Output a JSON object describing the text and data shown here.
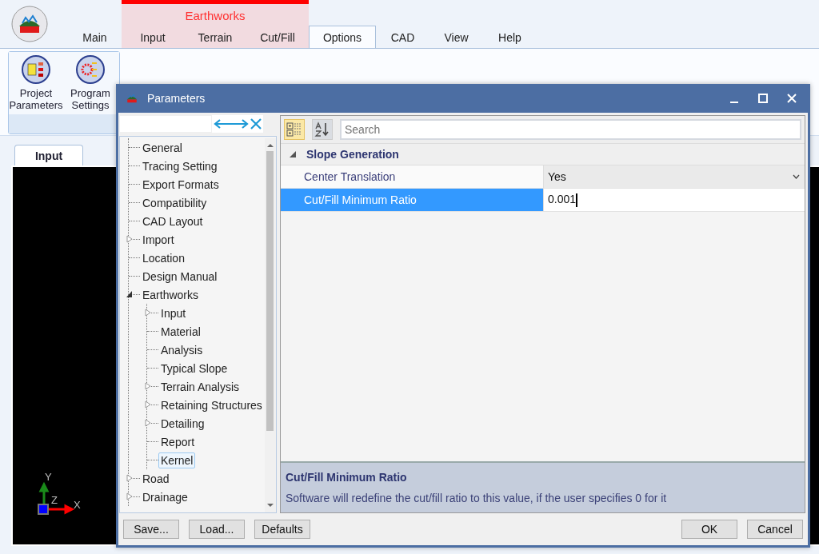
{
  "ribbon": {
    "context_group": "Earthworks",
    "tabs": [
      {
        "label": "Main",
        "kind": "plain",
        "selected": false
      },
      {
        "label": "Input",
        "kind": "contextual",
        "selected": false
      },
      {
        "label": "Terrain",
        "kind": "contextual",
        "selected": false
      },
      {
        "label": "Cut/Fill",
        "kind": "contextual",
        "selected": false
      },
      {
        "label": "Options",
        "kind": "plain",
        "selected": true
      },
      {
        "label": "CAD",
        "kind": "plain",
        "selected": false
      },
      {
        "label": "View",
        "kind": "plain",
        "selected": false
      },
      {
        "label": "Help",
        "kind": "plain",
        "selected": false
      }
    ],
    "buttons": [
      {
        "label": "Project Parameters",
        "kind": "project"
      },
      {
        "label": "Program Settings",
        "kind": "settings"
      }
    ]
  },
  "document_tabs": [
    {
      "label": "Input",
      "selected": true
    }
  ],
  "canvas_axes": {
    "y": "Y",
    "z": "Z",
    "x": "X"
  },
  "dialog": {
    "title": "Parameters",
    "tree": [
      {
        "label": "General",
        "selected": false
      },
      {
        "label": "Tracing Setting",
        "selected": false
      },
      {
        "label": "Export Formats",
        "selected": false
      },
      {
        "label": "Compatibility",
        "selected": false
      },
      {
        "label": "CAD Layout",
        "selected": false
      },
      {
        "label": "Import",
        "selected": false,
        "expanded": false
      },
      {
        "label": "Location",
        "selected": false
      },
      {
        "label": "Design Manual",
        "selected": false
      },
      {
        "label": "Earthworks",
        "selected": false,
        "expanded": true,
        "children": [
          {
            "label": "Input",
            "selected": false,
            "expanded": false
          },
          {
            "label": "Material",
            "selected": false
          },
          {
            "label": "Analysis",
            "selected": false
          },
          {
            "label": "Typical Slope",
            "selected": false
          },
          {
            "label": "Terrain Analysis",
            "selected": false,
            "expanded": false
          },
          {
            "label": "Retaining Structures",
            "selected": false,
            "expanded": false
          },
          {
            "label": "Detailing",
            "selected": false,
            "expanded": false
          },
          {
            "label": "Report",
            "selected": false
          },
          {
            "label": "Kernel",
            "selected": true
          }
        ]
      },
      {
        "label": "Road",
        "selected": false,
        "expanded": false
      },
      {
        "label": "Drainage",
        "selected": false,
        "expanded": false
      }
    ],
    "toolbar": [
      {
        "kind": "categorized",
        "selected": true
      },
      {
        "kind": "alphabetical",
        "selected": false
      }
    ],
    "search": {
      "placeholder": "Search"
    },
    "category": {
      "label": "Slope Generation",
      "expanded": true
    },
    "properties": [
      {
        "name": "Center Translation",
        "value": "Yes",
        "kind": "dropdown",
        "selected": false
      },
      {
        "name": "Cut/Fill Minimum Ratio",
        "value": "0.001",
        "kind": "text",
        "selected": true
      }
    ],
    "description": {
      "title": "Cut/Fill Minimum Ratio",
      "text": "Software will redefine the cut/fill ratio to this value, if the user specifies 0 for it"
    },
    "buttons_left": [
      "Save...",
      "Load...",
      "Defaults"
    ],
    "buttons_right": [
      "OK",
      "Cancel"
    ]
  }
}
